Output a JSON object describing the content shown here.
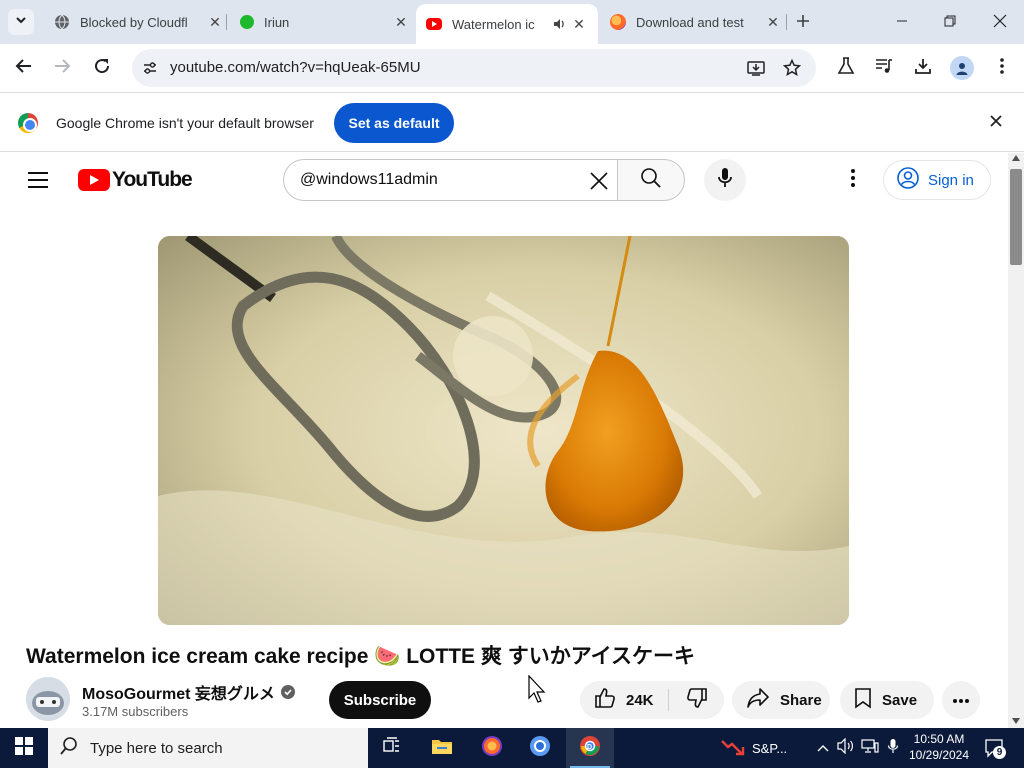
{
  "browser": {
    "tabs": [
      {
        "label": "Blocked by Cloudfl",
        "favicon": "globe-icon",
        "active": false
      },
      {
        "label": "Iriun",
        "favicon": "green-dot-icon",
        "active": false
      },
      {
        "label": "Watermelon ic",
        "favicon": "youtube-icon",
        "active": true
      },
      {
        "label": "Download and test",
        "favicon": "firefox-icon",
        "active": false
      }
    ],
    "url": "youtube.com/watch?v=hqUeak-65MU"
  },
  "infobar": {
    "message": "Google Chrome isn't your default browser",
    "button_label": "Set as default"
  },
  "youtube": {
    "logo_text": "YouTube",
    "search_value": "@windows11admin",
    "signin_label": "Sign in",
    "video": {
      "title": "Watermelon ice cream cake recipe 🍉 LOTTE 爽 すいかアイスケーキ",
      "channel_name": "MosoGourmet 妄想グルメ",
      "subscribers": "3.17M subscribers",
      "subscribe_label": "Subscribe",
      "likes": "24K",
      "share_label": "Share",
      "save_label": "Save"
    }
  },
  "taskbar": {
    "search_placeholder": "Type here to search",
    "stock_label": "S&P...",
    "time": "10:50 AM",
    "date": "10/29/2024",
    "notification_count": "9"
  },
  "colors": {
    "youtube_red": "#ff0000",
    "chrome_blue": "#0b57d0",
    "link_blue": "#065fd4",
    "taskbar": "#0b1a3a"
  }
}
